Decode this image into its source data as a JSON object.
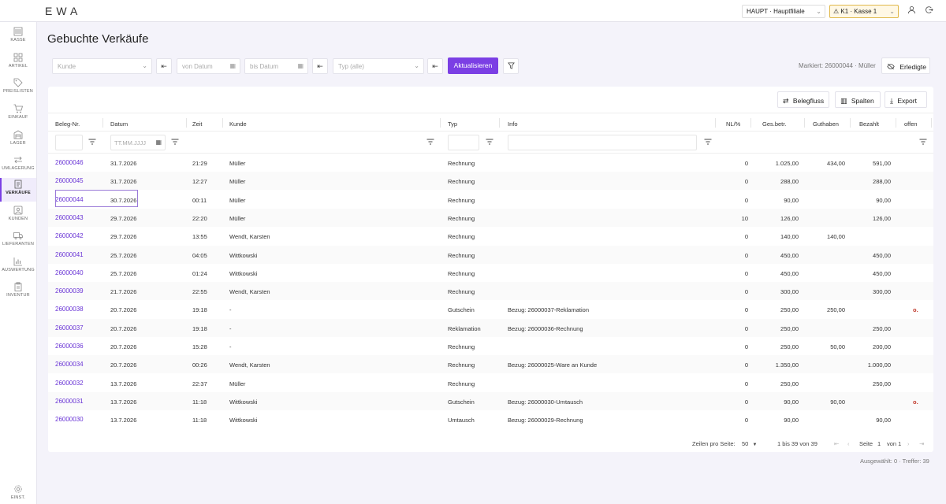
{
  "app": {
    "logo": "EWA",
    "branch": "HAUPT · Hauptfiliale",
    "kasse": "⚠ K1 · Kasse 1"
  },
  "sidebar": {
    "items": [
      {
        "label": "KASSE",
        "icon": "cash-register-icon"
      },
      {
        "label": "ARTIKEL",
        "icon": "grid-icon"
      },
      {
        "label": "PREISLISTEN",
        "icon": "tag-icon"
      },
      {
        "label": "EINKAUF",
        "icon": "cart-icon"
      },
      {
        "label": "LAGER",
        "icon": "warehouse-icon"
      },
      {
        "label": "UMLAGERUNG",
        "icon": "transfer-icon"
      },
      {
        "label": "VERKÄUFE",
        "icon": "receipt-icon",
        "active": true
      },
      {
        "label": "KUNDEN",
        "icon": "customer-icon"
      },
      {
        "label": "LIEFERANTEN",
        "icon": "truck-icon"
      },
      {
        "label": "AUSWERTUNG",
        "icon": "chart-icon"
      },
      {
        "label": "INVENTUR",
        "icon": "clipboard-icon"
      }
    ],
    "settings_label": "EINST."
  },
  "page": {
    "title": "Gebuchte Verkäufe"
  },
  "filters": {
    "kunde_placeholder": "Kunde",
    "von_placeholder": "von Datum",
    "bis_placeholder": "bis Datum",
    "typ_placeholder": "Typ (alle)",
    "refresh_label": "Aktualisieren",
    "marked_text": "Markiert: 26000044 · Müller",
    "erledigte_label": "Erledigte"
  },
  "toolbar": {
    "belegfluss_label": "Belegfluss",
    "spalten_label": "Spalten",
    "export_label": "Export"
  },
  "table": {
    "headers": {
      "beleg": "Beleg-Nr.",
      "datum": "Datum",
      "zeit": "Zeit",
      "kunde": "Kunde",
      "typ": "Typ",
      "info": "Info",
      "nl": "NL/%",
      "ges": "Ges.betr.",
      "guthaben": "Guthaben",
      "bezahlt": "Bezahlt",
      "offen": "offen"
    },
    "date_filter_placeholder": "TT.MM.JJJJ",
    "rows": [
      {
        "beleg": "26000046",
        "datum": "31.7.2026",
        "zeit": "21:29",
        "kunde": "Müller",
        "typ": "Rechnung",
        "info": "",
        "nl": "0",
        "ges": "1.025,00",
        "guthaben": "434,00",
        "bezahlt": "591,00",
        "offen": ""
      },
      {
        "beleg": "26000045",
        "datum": "31.7.2026",
        "zeit": "12:27",
        "kunde": "Müller",
        "typ": "Rechnung",
        "info": "",
        "nl": "0",
        "ges": "288,00",
        "guthaben": "",
        "bezahlt": "288,00",
        "offen": ""
      },
      {
        "beleg": "26000044",
        "datum": "30.7.2026",
        "zeit": "00:11",
        "kunde": "Müller",
        "typ": "Rechnung",
        "info": "",
        "nl": "0",
        "ges": "90,00",
        "guthaben": "",
        "bezahlt": "90,00",
        "offen": ""
      },
      {
        "beleg": "26000043",
        "datum": "29.7.2026",
        "zeit": "22:20",
        "kunde": "Müller",
        "typ": "Rechnung",
        "info": "",
        "nl": "10",
        "ges": "126,00",
        "guthaben": "",
        "bezahlt": "126,00",
        "offen": ""
      },
      {
        "beleg": "26000042",
        "datum": "29.7.2026",
        "zeit": "13:55",
        "kunde": "Wendt, Karsten",
        "typ": "Rechnung",
        "info": "",
        "nl": "0",
        "ges": "140,00",
        "guthaben": "140,00",
        "bezahlt": "",
        "offen": ""
      },
      {
        "beleg": "26000041",
        "datum": "25.7.2026",
        "zeit": "04:05",
        "kunde": "Wittkowski",
        "typ": "Rechnung",
        "info": "",
        "nl": "0",
        "ges": "450,00",
        "guthaben": "",
        "bezahlt": "450,00",
        "offen": ""
      },
      {
        "beleg": "26000040",
        "datum": "25.7.2026",
        "zeit": "01:24",
        "kunde": "Wittkowski",
        "typ": "Rechnung",
        "info": "",
        "nl": "0",
        "ges": "450,00",
        "guthaben": "",
        "bezahlt": "450,00",
        "offen": ""
      },
      {
        "beleg": "26000039",
        "datum": "21.7.2026",
        "zeit": "22:55",
        "kunde": "Wendt, Karsten",
        "typ": "Rechnung",
        "info": "",
        "nl": "0",
        "ges": "300,00",
        "guthaben": "",
        "bezahlt": "300,00",
        "offen": ""
      },
      {
        "beleg": "26000038",
        "datum": "20.7.2026",
        "zeit": "19:18",
        "kunde": "-",
        "typ": "Gutschein",
        "info": "Bezug: 26000037-Reklamation",
        "nl": "0",
        "ges": "250,00",
        "guthaben": "250,00",
        "bezahlt": "",
        "offen": "o."
      },
      {
        "beleg": "26000037",
        "datum": "20.7.2026",
        "zeit": "19:18",
        "kunde": "-",
        "typ": "Reklamation",
        "info": "Bezug: 26000036-Rechnung",
        "nl": "0",
        "ges": "250,00",
        "guthaben": "",
        "bezahlt": "250,00",
        "offen": ""
      },
      {
        "beleg": "26000036",
        "datum": "20.7.2026",
        "zeit": "15:28",
        "kunde": "-",
        "typ": "Rechnung",
        "info": "",
        "nl": "0",
        "ges": "250,00",
        "guthaben": "50,00",
        "bezahlt": "200,00",
        "offen": ""
      },
      {
        "beleg": "26000034",
        "datum": "20.7.2026",
        "zeit": "00:26",
        "kunde": "Wendt, Karsten",
        "typ": "Rechnung",
        "info": "Bezug: 26000025-Ware an Kunde",
        "nl": "0",
        "ges": "1.350,00",
        "guthaben": "",
        "bezahlt": "1.000,00",
        "offen": ""
      },
      {
        "beleg": "26000032",
        "datum": "13.7.2026",
        "zeit": "22:37",
        "kunde": "Müller",
        "typ": "Rechnung",
        "info": "",
        "nl": "0",
        "ges": "250,00",
        "guthaben": "",
        "bezahlt": "250,00",
        "offen": ""
      },
      {
        "beleg": "26000031",
        "datum": "13.7.2026",
        "zeit": "11:18",
        "kunde": "Wittkowski",
        "typ": "Gutschein",
        "info": "Bezug: 26000030-Umtausch",
        "nl": "0",
        "ges": "90,00",
        "guthaben": "90,00",
        "bezahlt": "",
        "offen": "o."
      },
      {
        "beleg": "26000030",
        "datum": "13.7.2026",
        "zeit": "11:18",
        "kunde": "Wittkowski",
        "typ": "Umtausch",
        "info": "Bezug: 26000029-Rechnung",
        "nl": "0",
        "ges": "90,00",
        "guthaben": "",
        "bezahlt": "90,00",
        "offen": ""
      }
    ]
  },
  "pagination": {
    "rows_per_page_label": "Zeilen pro Seite:",
    "rows_per_page": "50",
    "range": "1 bis 39 von 39",
    "page_label": "Seite",
    "page": "1",
    "of_label": "von 1"
  },
  "status": "Ausgewählt: 0 · Treffer: 39",
  "colors": {
    "accent": "#7b3fe4",
    "link": "#6a35d6",
    "flag": "#c0392b"
  }
}
